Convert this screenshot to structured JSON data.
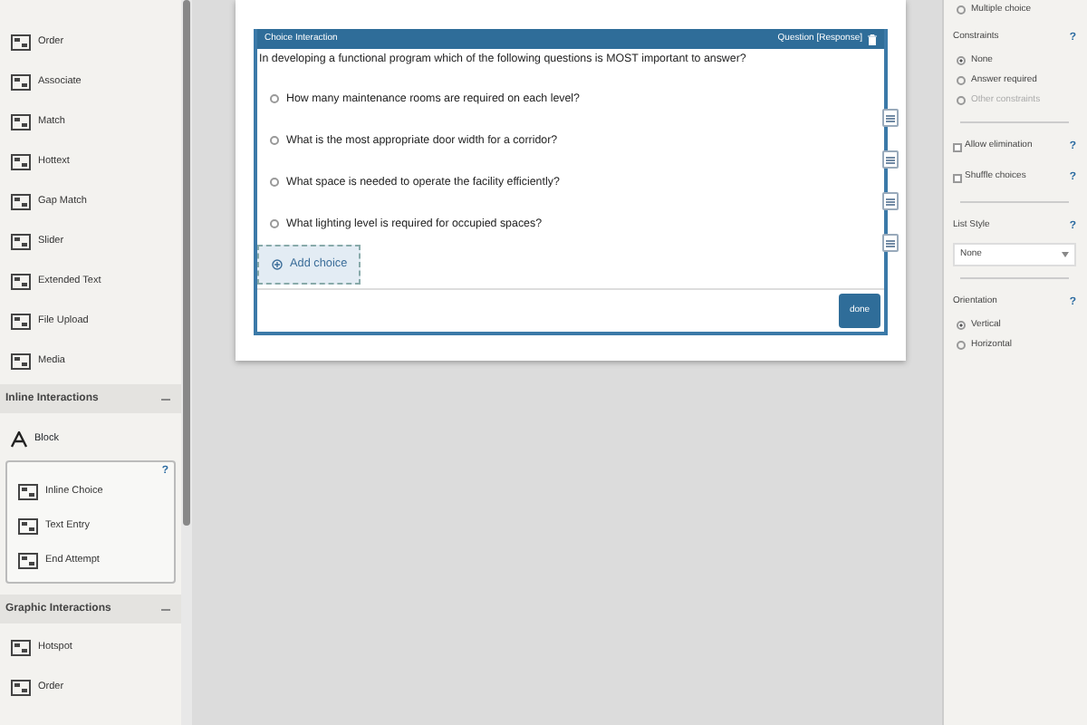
{
  "sidebar": {
    "items": [
      {
        "kind": "item",
        "label": "Order"
      },
      {
        "kind": "item",
        "label": "Associate"
      },
      {
        "kind": "item",
        "label": "Match"
      },
      {
        "kind": "item",
        "label": "Hottext"
      },
      {
        "kind": "item",
        "label": "Gap Match"
      },
      {
        "kind": "item",
        "label": "Slider"
      },
      {
        "kind": "item",
        "label": "Extended Text"
      },
      {
        "kind": "item",
        "label": "File Upload"
      },
      {
        "kind": "item",
        "label": "Media"
      },
      {
        "kind": "section",
        "label": "Inline Interactions",
        "expanded": true
      },
      {
        "kind": "block",
        "label": "Block"
      },
      {
        "kind": "group",
        "help": "?",
        "children": [
          {
            "label": "Inline Choice"
          },
          {
            "label": "Text Entry"
          },
          {
            "label": "End Attempt"
          }
        ]
      },
      {
        "kind": "section",
        "label": "Graphic Interactions",
        "expanded": true
      },
      {
        "kind": "item",
        "label": "Hotspot"
      },
      {
        "kind": "item",
        "label": "Order"
      }
    ]
  },
  "interaction": {
    "title": "Choice Interaction",
    "response": "Question [Response]",
    "prompt": "In developing a functional program which of the following questions is MOST important to answer?",
    "choices": [
      {
        "label": "How many maintenance rooms are required on each level?",
        "checked": false
      },
      {
        "label": "What is the most appropriate door width for a corridor?",
        "checked": false
      },
      {
        "label": "What space is needed to operate the facility efficiently?",
        "checked": false
      },
      {
        "label": "What lighting level is required for occupied spaces?",
        "checked": false
      }
    ],
    "add_choice": "Add choice",
    "done": "done"
  },
  "properties": [
    {
      "kind": "radio",
      "label": "Multiple choice",
      "selected": false,
      "disabled": false
    },
    {
      "kind": "heading",
      "label": "Constraints",
      "help": "?"
    },
    {
      "kind": "radio",
      "label": "None",
      "selected": true,
      "disabled": false
    },
    {
      "kind": "radio",
      "label": "Answer required",
      "selected": false,
      "disabled": false
    },
    {
      "kind": "radio",
      "label": "Other constraints",
      "selected": false,
      "disabled": true
    },
    {
      "kind": "separator"
    },
    {
      "kind": "checkbox",
      "label": "Allow elimination",
      "checked": false,
      "help": "?"
    },
    {
      "kind": "checkbox",
      "label": "Shuffle choices",
      "checked": false,
      "help": "?"
    },
    {
      "kind": "separator"
    },
    {
      "kind": "heading",
      "label": "List Style",
      "help": "?"
    },
    {
      "kind": "select",
      "value": "None"
    },
    {
      "kind": "separator"
    },
    {
      "kind": "heading",
      "label": "Orientation",
      "help": "?"
    },
    {
      "kind": "radio",
      "label": "Vertical",
      "selected": true,
      "disabled": false
    },
    {
      "kind": "radio",
      "label": "Horizontal",
      "selected": false,
      "disabled": false
    }
  ]
}
